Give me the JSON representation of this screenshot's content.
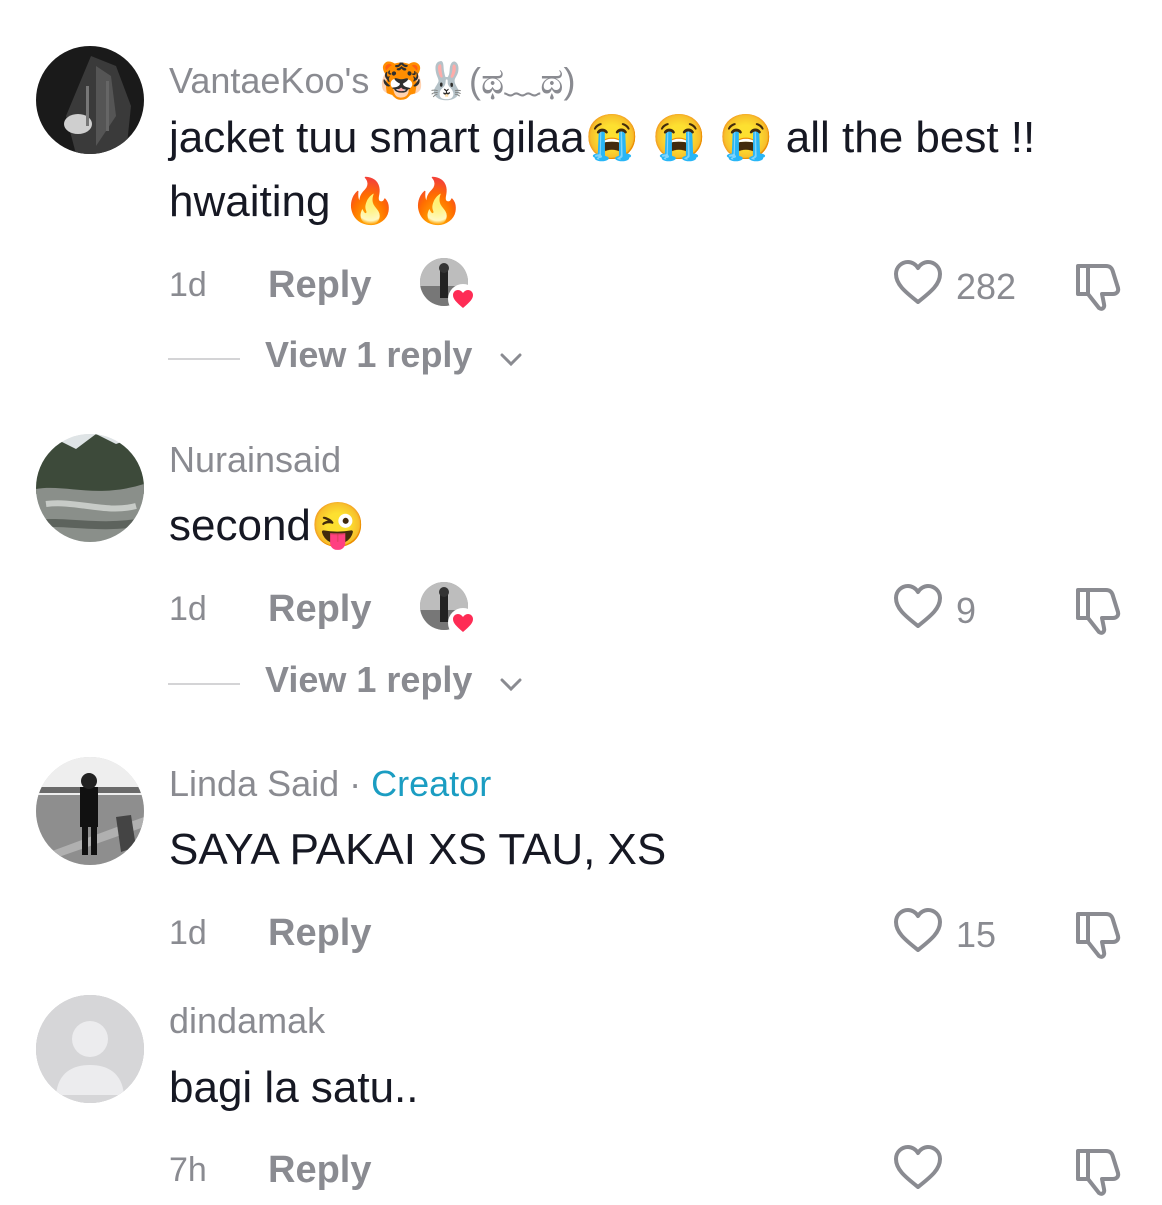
{
  "comments": [
    {
      "username": "VantaeKoo's 🐯🐰(ಥ﹏ಥ)",
      "text": "jacket tuu smart gilaa😭 😭 😭 all the best !! hwaiting 🔥 🔥",
      "time": "1d",
      "reply_label": "Reply",
      "likes": "282",
      "liked_by_creator": true,
      "view_replies": "View 1 reply"
    },
    {
      "username": "Nurainsaid",
      "text": "second😜",
      "time": "1d",
      "reply_label": "Reply",
      "likes": "9",
      "liked_by_creator": true,
      "view_replies": "View 1 reply"
    },
    {
      "username": "Linda Said",
      "creator_separator": " · ",
      "creator_label": "Creator",
      "text": "SAYA PAKAI XS TAU, XS",
      "time": "1d",
      "reply_label": "Reply",
      "likes": "15",
      "liked_by_creator": false
    },
    {
      "username": "dindamak",
      "text": "bagi la satu..",
      "time": "7h",
      "reply_label": "Reply",
      "likes": "",
      "liked_by_creator": false
    }
  ],
  "icons": {
    "like": "heart-outline-icon",
    "dislike": "thumbs-down-outline-icon",
    "chevron": "chevron-down-icon",
    "creator_like_badge": "red-heart-icon"
  },
  "colors": {
    "creator_accent": "#1b9dc2",
    "muted_text": "#8a8b91",
    "heart_badge": "#fe2c55"
  }
}
